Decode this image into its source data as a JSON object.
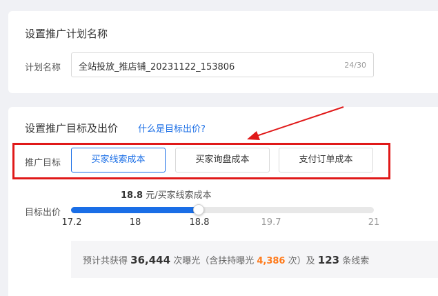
{
  "plan_section": {
    "title": "设置推广计划名称",
    "name_label": "计划名称",
    "name_value": "全站投放_推店铺_20231122_153806",
    "char_count": "24/30"
  },
  "goal_section": {
    "title": "设置推广目标及出价",
    "help_link": "什么是目标出价?",
    "goal_label": "推广目标",
    "goals": [
      {
        "label": "买家线索成本",
        "selected": true
      },
      {
        "label": "买家询盘成本",
        "selected": false
      },
      {
        "label": "支付订单成本",
        "selected": false
      }
    ],
    "bid_label": "目标出价",
    "bid_value": "18.8",
    "bid_unit": "元/买家线索成本",
    "slider": {
      "min": 17.2,
      "max": 21,
      "value": 18.8,
      "ticks": [
        "17.2",
        "18",
        "18.8",
        "19.7",
        "21"
      ]
    },
    "estimate": {
      "prefix": "预计共获得",
      "exposure": "36,444",
      "exposure_unit": "次曝光（含扶持曝光",
      "support_exposure": "4,386",
      "support_suffix": "次）及",
      "leads": "123",
      "leads_unit": "条线索"
    }
  },
  "colors": {
    "accent": "#1a6ee6",
    "highlight": "#e01919",
    "orange": "#ff7a1a"
  }
}
